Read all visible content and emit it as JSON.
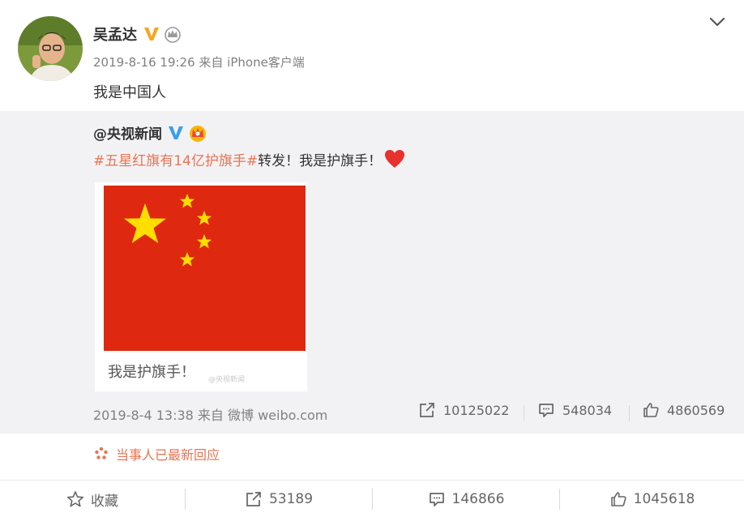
{
  "post": {
    "author": "吴孟达",
    "timestamp": "2019-8-16 19:26",
    "source": "来自 iPhone客户端",
    "text": "我是中国人"
  },
  "repost": {
    "author": "@央视新闻",
    "hashtag": "#五星红旗有14亿护旗手#",
    "text": "转发！我是护旗手！",
    "image_caption": "我是护旗手！",
    "image_watermark": "@央视新闻",
    "timestamp": "2019-8-4 13:38",
    "source": "来自 微博 weibo.com",
    "reposts": "10125022",
    "comments": "548034",
    "likes": "4860569"
  },
  "notice": "当事人已最新回应",
  "actions": {
    "favorite": "收藏",
    "reposts": "53189",
    "comments": "146866",
    "likes": "1045618"
  },
  "colors": {
    "accent": "#eb7350",
    "verified": "#f5a623",
    "repost_bg": "#f2f2f5",
    "flag_red": "#de2910",
    "flag_star": "#ffde00"
  },
  "icons": [
    "verified-v-icon",
    "crown-icon",
    "chevron-down-icon",
    "heart-icon",
    "repost-icon",
    "comment-icon",
    "like-icon",
    "star-icon",
    "spark-icon"
  ]
}
